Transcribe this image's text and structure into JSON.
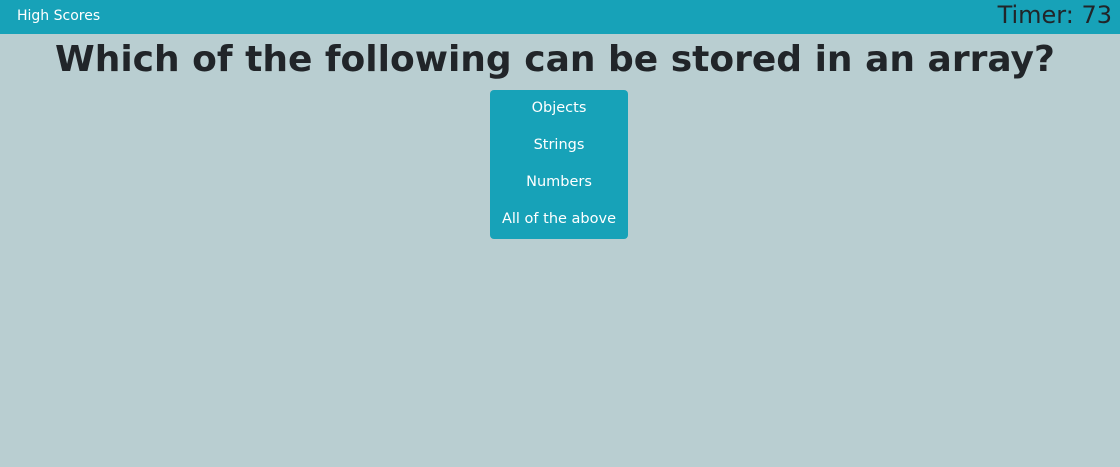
{
  "navbar": {
    "high_scores_label": "High Scores",
    "timer_text": "Timer: 73"
  },
  "quiz": {
    "question": "Which of the following can be stored in an array?",
    "answers": [
      "Objects",
      "Strings",
      "Numbers",
      "All of the above"
    ]
  },
  "colors": {
    "background": "#b9ced1",
    "accent": "#17a2b8",
    "text": "#212529",
    "button_text": "#ffffff"
  }
}
